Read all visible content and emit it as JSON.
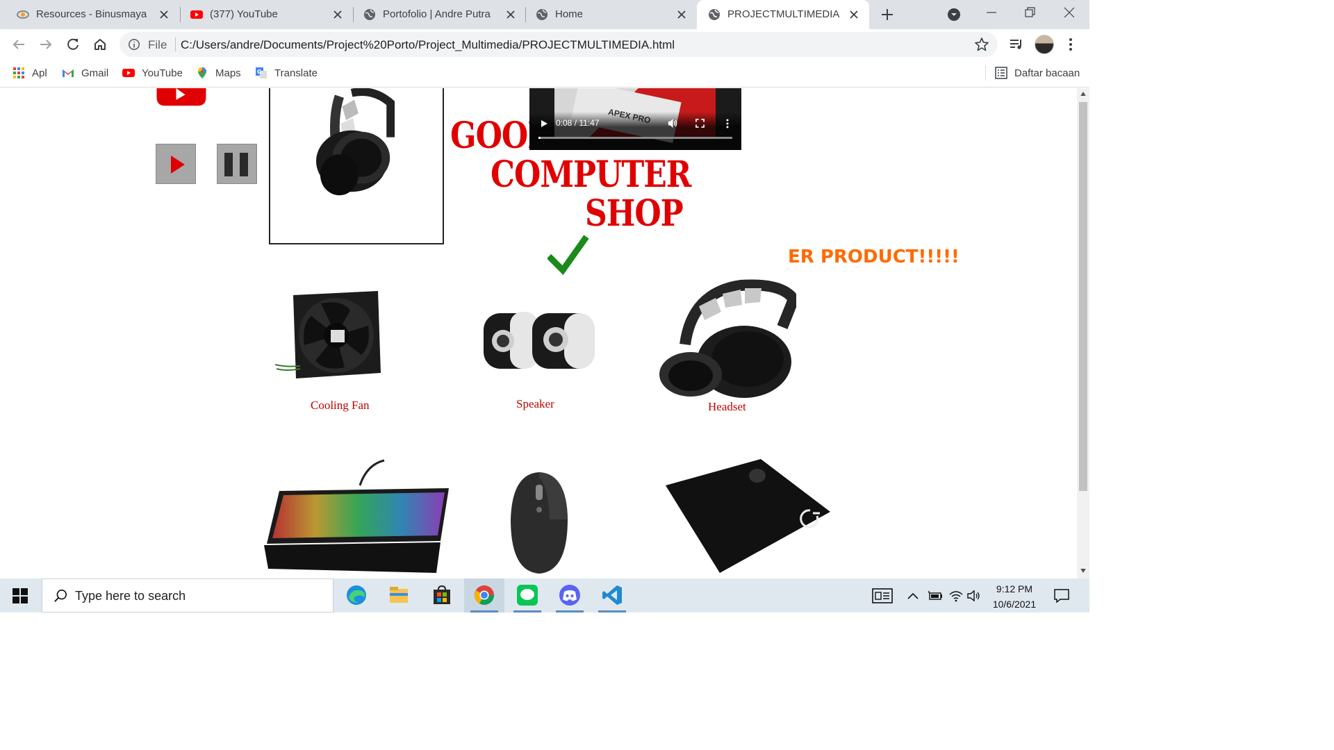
{
  "tabs": [
    {
      "label": "Resources - Binusmaya",
      "icon": "binusmaya-icon"
    },
    {
      "label": "(377) YouTube",
      "icon": "youtube-icon"
    },
    {
      "label": "Portofolio | Andre Putra",
      "icon": "globe-icon"
    },
    {
      "label": "Home",
      "icon": "globe-icon"
    },
    {
      "label": "PROJECTMULTIMEDIA",
      "icon": "globe-icon",
      "active": true
    }
  ],
  "omnibox": {
    "scheme_label": "File",
    "url": "C:/Users/andre/Documents/Project%20Porto/Project_Multimedia/PROJECTMULTIMEDIA.html"
  },
  "bookmarks": {
    "items": [
      {
        "label": "Apl",
        "icon": "apps-grid-icon"
      },
      {
        "label": "Gmail",
        "icon": "gmail-icon"
      },
      {
        "label": "YouTube",
        "icon": "youtube-icon"
      },
      {
        "label": "Maps",
        "icon": "maps-icon"
      },
      {
        "label": "Translate",
        "icon": "translate-icon"
      }
    ],
    "reading_list": "Daftar bacaan"
  },
  "page": {
    "shop_title": [
      "GOOD",
      "COMPUTER",
      "SHOP"
    ],
    "marquee_text": "ER PRODUCT!!!!!",
    "video": {
      "time": "0:08 / 11:47",
      "progress": 0.0113,
      "caption": "APEX PRO"
    },
    "products": [
      {
        "caption": "Cooling Fan"
      },
      {
        "caption": "Speaker"
      },
      {
        "caption": "Headset"
      },
      {
        "caption": ""
      },
      {
        "caption": ""
      },
      {
        "caption": ""
      }
    ]
  },
  "taskbar": {
    "search_placeholder": "Type here to search",
    "time": "9:12 PM",
    "date": "10/6/2021"
  },
  "colors": {
    "shop_red": "#e00000",
    "marquee_orange": "#ff6a00",
    "check_green": "#1a8a1a",
    "caption_red": "#c00000"
  }
}
